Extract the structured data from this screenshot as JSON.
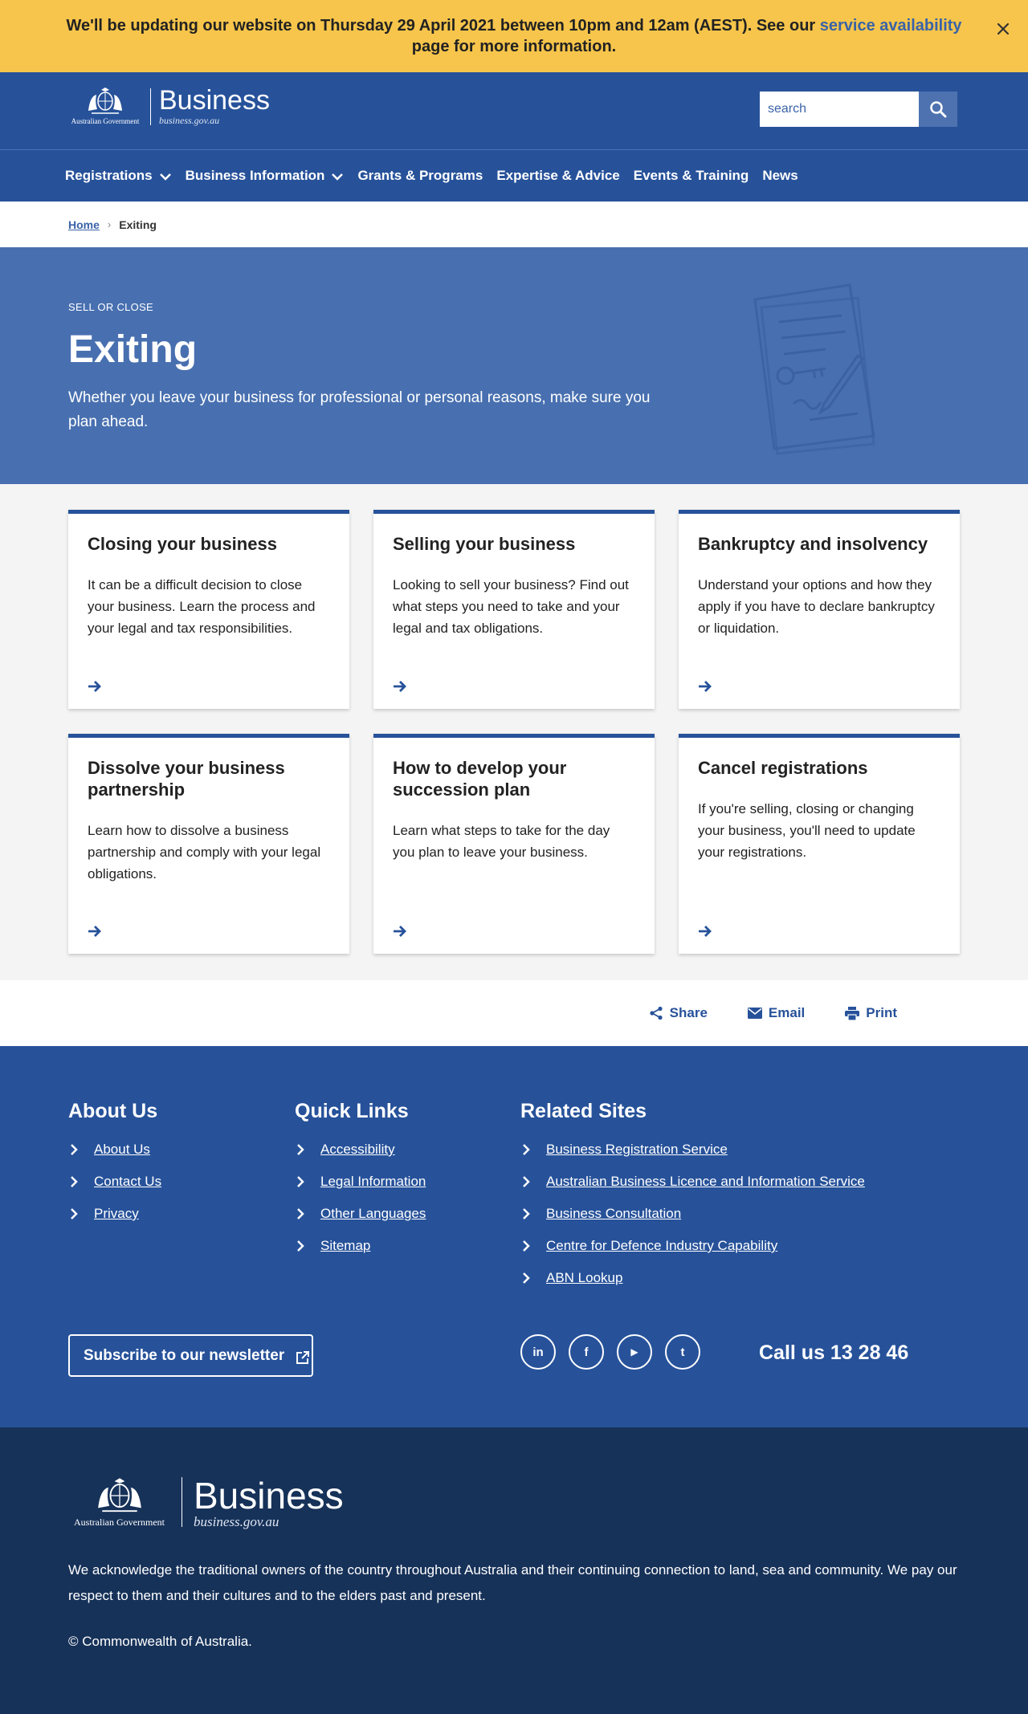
{
  "alert": {
    "text_before": "We'll be updating our website on Thursday 29 April 2021 between 10pm and 12am (AEST). See our ",
    "link": "service availability",
    "text_after": " page for more information.",
    "close_icon": "close-icon"
  },
  "header": {
    "crest_text": "Australian Government",
    "brand": "Business",
    "url": "business.gov.au",
    "search_placeholder": "search",
    "search_icon": "search-icon"
  },
  "nav": {
    "items": [
      {
        "label": "Registrations",
        "has_dropdown": true
      },
      {
        "label": "Business Information",
        "has_dropdown": true
      },
      {
        "label": "Grants & Programs",
        "has_dropdown": false
      },
      {
        "label": "Expertise & Advice",
        "has_dropdown": false
      },
      {
        "label": "Events & Training",
        "has_dropdown": false
      },
      {
        "label": "News",
        "has_dropdown": false
      }
    ]
  },
  "breadcrumb": {
    "home": "Home",
    "separator": "›",
    "current": "Exiting"
  },
  "hero": {
    "eyebrow": "SELL OR CLOSE",
    "title": "Exiting",
    "description": "Whether you leave your business for professional or personal reasons, make sure you plan ahead."
  },
  "cards": [
    {
      "title": "Closing your business",
      "desc": "It can be a difficult decision to close your business. Learn the process and your legal and tax responsibilities."
    },
    {
      "title": "Selling your business",
      "desc": "Looking to sell your business? Find out what steps you need to take and your legal and tax obligations."
    },
    {
      "title": "Bankruptcy and insolvency",
      "desc": "Understand your options and how they apply if you have to declare bankruptcy or liquidation."
    },
    {
      "title": "Dissolve your business partnership",
      "desc": "Learn how to dissolve a business partnership and comply with your legal obligations."
    },
    {
      "title": "How to develop your succession plan",
      "desc": "Learn what steps to take for the day you plan to leave your business."
    },
    {
      "title": "Cancel registrations",
      "desc": "If you're selling, closing or changing your business, you'll need to update your registrations."
    }
  ],
  "share": {
    "share": "Share",
    "email": "Email",
    "print": "Print"
  },
  "footer": {
    "about": {
      "heading": "About Us",
      "links": [
        "About Us",
        "Contact Us",
        "Privacy"
      ]
    },
    "quick": {
      "heading": "Quick Links",
      "links": [
        "Accessibility",
        "Legal Information",
        "Other Languages",
        "Sitemap"
      ]
    },
    "related": {
      "heading": "Related Sites",
      "links": [
        "Business Registration Service",
        "Australian Business Licence and Information Service",
        "Business Consultation",
        "Centre for Defence Industry Capability",
        "ABN Lookup"
      ]
    },
    "newsletter": "Subscribe to our newsletter",
    "socials": [
      {
        "name": "linkedin-icon",
        "glyph": "in"
      },
      {
        "name": "facebook-icon",
        "glyph": "f"
      },
      {
        "name": "youtube-icon",
        "glyph": "▶"
      },
      {
        "name": "twitter-icon",
        "glyph": "t"
      }
    ],
    "call": "Call us 13 28 46"
  },
  "footer_bottom": {
    "crest_text": "Australian Government",
    "brand": "Business",
    "url": "business.gov.au",
    "acknowledgement": "We acknowledge the traditional owners of the country throughout Australia and their continuing connection to land, sea and community. We pay our respect to them and their cultures and to the elders past and present.",
    "copyright": "© Commonwealth of Australia."
  },
  "colors": {
    "alert_bg": "#f7c54b",
    "primary": "#27529a",
    "hero_bg": "#4870b0",
    "footer_dark": "#173259",
    "link": "#3a63a7"
  }
}
